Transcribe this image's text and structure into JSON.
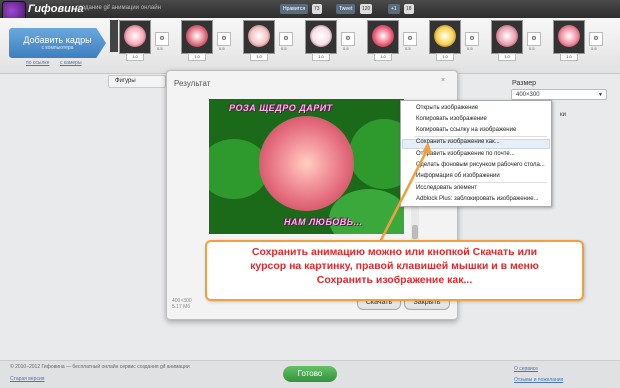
{
  "header": {
    "logo": "Гифовина",
    "tagline": "создание gif анимации онлайн",
    "buttons": [
      {
        "label": "Нравится",
        "count": "73"
      },
      {
        "label": "Tweet",
        "count": "120"
      },
      {
        "label": "+1",
        "count": "18"
      }
    ]
  },
  "strip": {
    "add_label": "Добавить кадры",
    "add_sub": "с компьютера",
    "link1": "по ссылке",
    "link2": "с камеры",
    "frames": [
      {
        "duration": "1.0",
        "color": "#f7a9b8"
      },
      {
        "duration": "1.0",
        "color": "#e07080"
      },
      {
        "duration": "1.0",
        "color": "#f2c2c2"
      },
      {
        "duration": "1.0",
        "color": "#f6e0e8"
      },
      {
        "duration": "1.0",
        "color": "#f0607a"
      },
      {
        "duration": "1.0",
        "color": "#f8d34a"
      },
      {
        "duration": "1.0",
        "color": "#e8a0b0"
      },
      {
        "duration": "1.0",
        "color": "#f28aa0"
      }
    ],
    "ctrl_value": "0.5"
  },
  "main": {
    "left_tab": "Фигуры",
    "right_label": "Размер",
    "size_value": "400×300",
    "side_label": "ки"
  },
  "dialog": {
    "title": "Результат",
    "close": "×",
    "image_top": "РОЗА ЩЕДРО ДАРИТ",
    "image_bottom": "НАМ ЛЮБОВЬ...",
    "meta1": "400×300",
    "meta2": "5.17 Мб",
    "download": "Скачать",
    "close_btn": "Закрыть"
  },
  "context_menu": [
    "Открыть изображение",
    "Копировать изображение",
    "Копировать ссылку на изображение",
    "Сохранить изображение как...",
    "Отправить изображение по почте...",
    "Сделать фоновым рисунком рабочего стола...",
    "Информация об изображении",
    "Исследовать элемент",
    "Adblock Plus: заблокировать изображение..."
  ],
  "callout": {
    "line1": "Сохранить анимацию можно или кнопкой Скачать или",
    "line2": "курсор на картинку, правой клавишей мышки и в меню",
    "line3": "Сохранить изображение как..."
  },
  "footer": {
    "left": "© 2010–2012 Гифовина — бесплатный онлайн сервис создания gif анимации",
    "left2": "Старая версия",
    "done": "Готово",
    "right1": "О сервисе",
    "right2": "Отзывы и пожелания"
  }
}
